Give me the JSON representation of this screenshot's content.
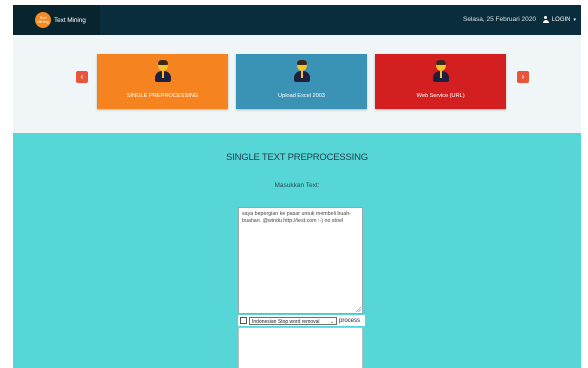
{
  "navbar": {
    "logo_text": "Text Mining",
    "brand_title": "Text Mining",
    "date": "Selasa, 25 Februari 2020",
    "login_label": "LOGIN",
    "login_caret": "▾"
  },
  "carousel": {
    "prev_icon": "‹",
    "next_icon": "›",
    "cards": [
      {
        "label": "SINGLE PREPROCESSING",
        "color": "#f5831f",
        "icon": "user-icon"
      },
      {
        "label": "Upload Excel 2003",
        "color": "#3a92b4",
        "icon": "user-icon"
      },
      {
        "label": "Web Service (URL)",
        "color": "#d31f1f",
        "icon": "user-icon"
      }
    ]
  },
  "main": {
    "title": "SINGLE TEXT PREPROCESSING",
    "prompt": "Masukkan Text:",
    "input_text": "saya bepergian ke pasar untuk membeli buah-buahan.  @windu http://test.com :-) no stoel",
    "select_value": "Indonesian Stop word removal",
    "select_chevron": "⌄",
    "process_label": "process",
    "output_text": ""
  },
  "colors": {
    "navbar": "#0a2d3d",
    "main_bg": "#56d6d6",
    "arrow": "#e8553a"
  }
}
